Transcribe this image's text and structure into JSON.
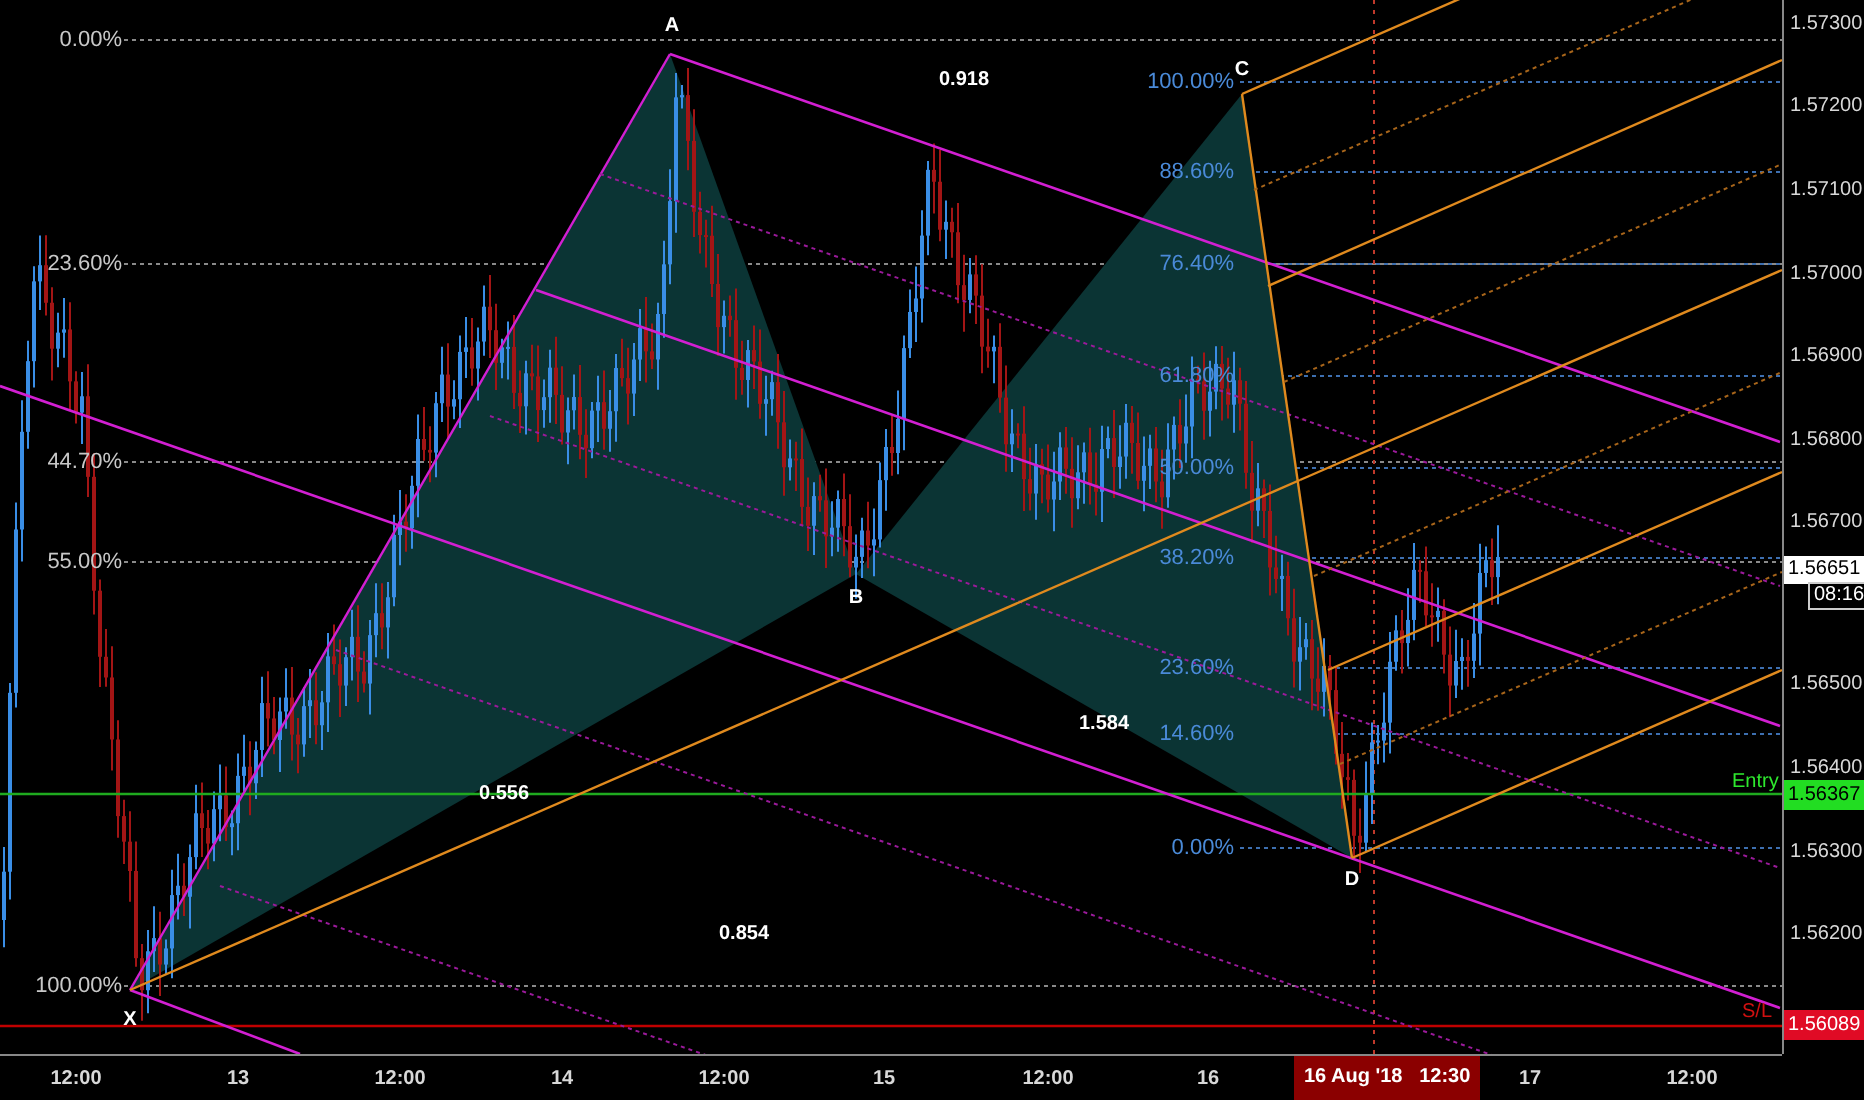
{
  "chart": {
    "pattern_points": [
      "X",
      "A",
      "B",
      "C",
      "D"
    ],
    "ratios": [
      "0.918",
      "0.556",
      "0.854",
      "1.584"
    ],
    "xa_fib_levels": [
      "0.00%",
      "23.60%",
      "44.70%",
      "55.00%",
      "100.00%"
    ],
    "cd_fib_levels": [
      "100.00%",
      "88.60%",
      "76.40%",
      "61.80%",
      "50.00%",
      "38.20%",
      "23.60%",
      "14.60%",
      "0.00%"
    ],
    "entry_label": "Entry",
    "stop_loss_label": "S/L"
  },
  "price_axis": {
    "ticks": [
      "1.57300",
      "1.57200",
      "1.57100",
      "1.57000",
      "1.56900",
      "1.56800",
      "1.56700",
      "1.56500",
      "1.56400",
      "1.56300",
      "1.56200"
    ],
    "current_price": "1.56651",
    "countdown": "08:16",
    "entry_price": "1.56367",
    "stop_loss_price": "1.56089"
  },
  "time_axis": {
    "ticks": [
      "12:00",
      "13",
      "12:00",
      "14",
      "12:00",
      "15",
      "12:00",
      "16",
      "17",
      "12:00"
    ],
    "crosshair_label": "16 Aug '18   12:30"
  }
}
